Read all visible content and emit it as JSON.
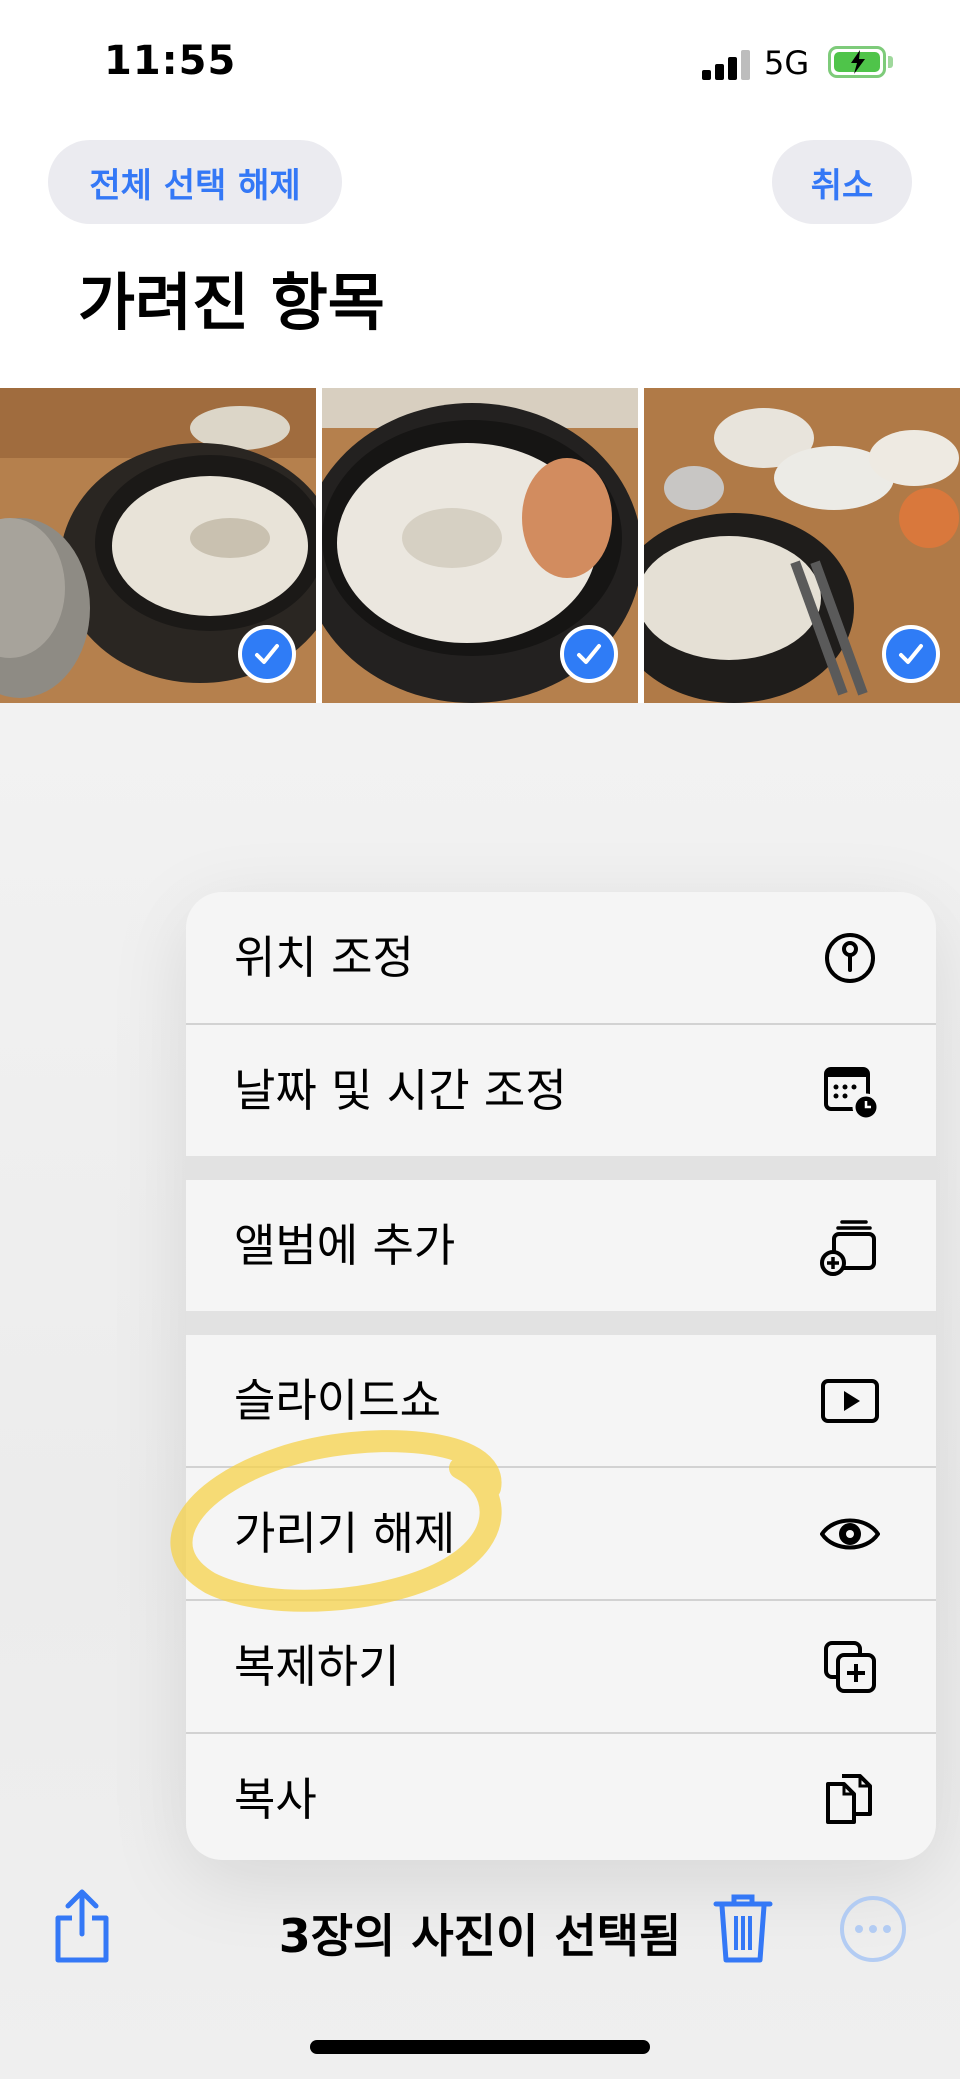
{
  "status_bar": {
    "time": "11:55",
    "network": "5G"
  },
  "header": {
    "deselect_all": "전체 선택 해제",
    "cancel": "취소",
    "title": "가려진 항목"
  },
  "photos": [
    {
      "name": "photo-1",
      "selected": true
    },
    {
      "name": "photo-2",
      "selected": true
    },
    {
      "name": "photo-3",
      "selected": true
    }
  ],
  "menu": {
    "items": [
      {
        "label": "위치 조정",
        "icon": "location-pin-icon"
      },
      {
        "label": "날짜 및 시간 조정",
        "icon": "calendar-clock-icon"
      },
      {
        "label": "앨범에 추가",
        "icon": "add-to-album-icon"
      },
      {
        "label": "슬라이드쇼",
        "icon": "play-icon"
      },
      {
        "label": "가리기 해제",
        "icon": "eye-icon"
      },
      {
        "label": "복제하기",
        "icon": "duplicate-icon"
      },
      {
        "label": "복사",
        "icon": "copy-icon"
      }
    ]
  },
  "toolbar": {
    "selected_text": "3장의 사진이 선택됨"
  },
  "colors": {
    "accent": "#3478f6",
    "highlight": "#f6d24a",
    "battery": "#4fc44a"
  }
}
